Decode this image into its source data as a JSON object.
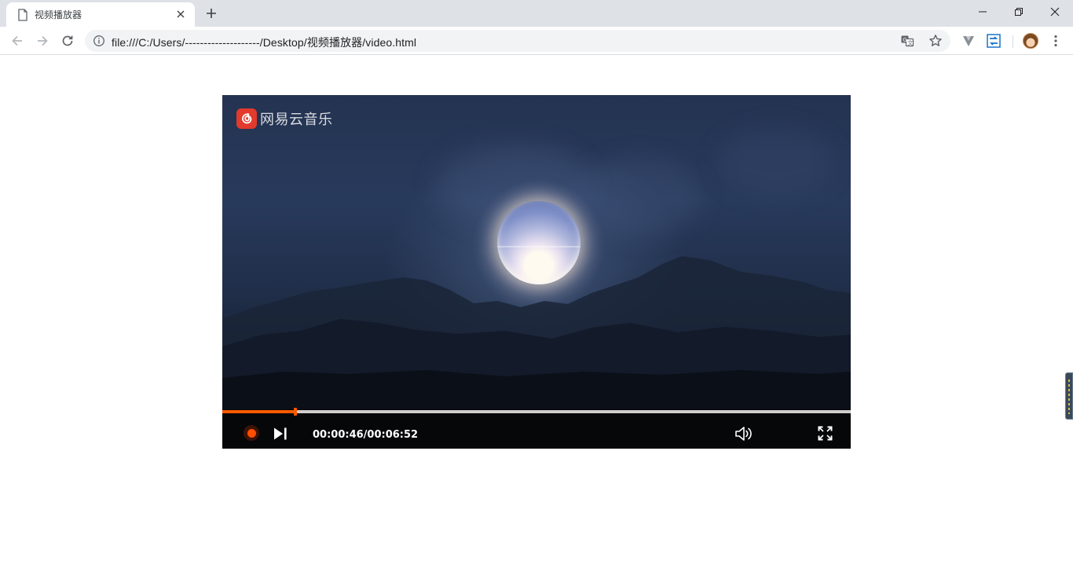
{
  "browser": {
    "tab": {
      "title": "视频播放器",
      "icon": "page-icon"
    },
    "address_bar": {
      "url": "file:///C:/Users/--------------------/Desktop/视频播放器/video.html"
    }
  },
  "player": {
    "brand": "网易云音乐",
    "current_time": "00:00:46",
    "duration": "00:06:52",
    "time_display": "00:00:46/00:06:52",
    "progress_fraction": 0.116,
    "accent_color": "#ff5a00",
    "state": "paused"
  },
  "icons": [
    "page-icon",
    "close-icon",
    "new-tab-icon",
    "minimize-icon",
    "restore-icon",
    "window-close-icon",
    "back-icon",
    "forward-icon",
    "reload-icon",
    "info-icon",
    "translate-icon",
    "star-icon",
    "vpn-extension-icon",
    "sync-extension-icon",
    "avatar",
    "more-menu-icon",
    "netease-logo-icon",
    "play-icon",
    "next-icon",
    "volume-icon",
    "fullscreen-icon"
  ]
}
